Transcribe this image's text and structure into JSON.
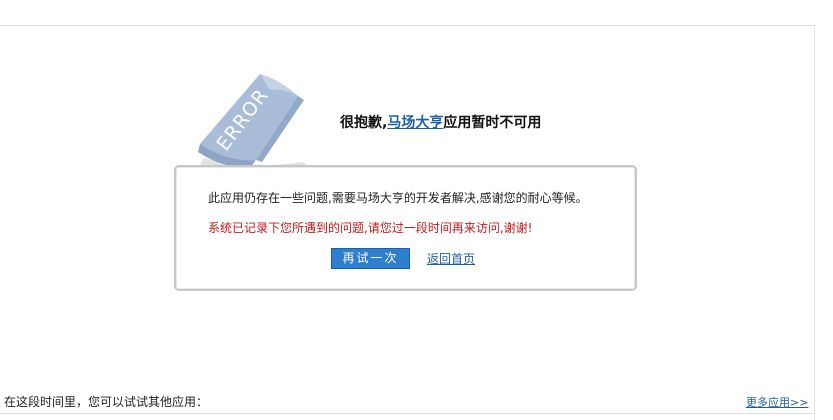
{
  "headline": {
    "prefix": "很抱歉,",
    "app_name": "马场大亨",
    "suffix": "应用暂时不可用"
  },
  "error_graphic": {
    "text": "ERROR"
  },
  "message_box": {
    "line1": "此应用仍存在一些问题,需要马场大亨的开发者解决,感谢您的耐心等候。",
    "line2": "系统已记录下您所遇到的问题,请您过一段时间再来访问,谢谢!",
    "retry_label": "再试一次",
    "home_link_label": "返回首页"
  },
  "footer": {
    "hint": "在这段时间里，您可以试试其他应用：",
    "more_apps_label": "更多应用>>"
  },
  "colors": {
    "link": "#1f5f9f",
    "warning_text": "#c41a1a",
    "button_bg": "#2f7fd0",
    "paper": "#a9bcd8"
  }
}
